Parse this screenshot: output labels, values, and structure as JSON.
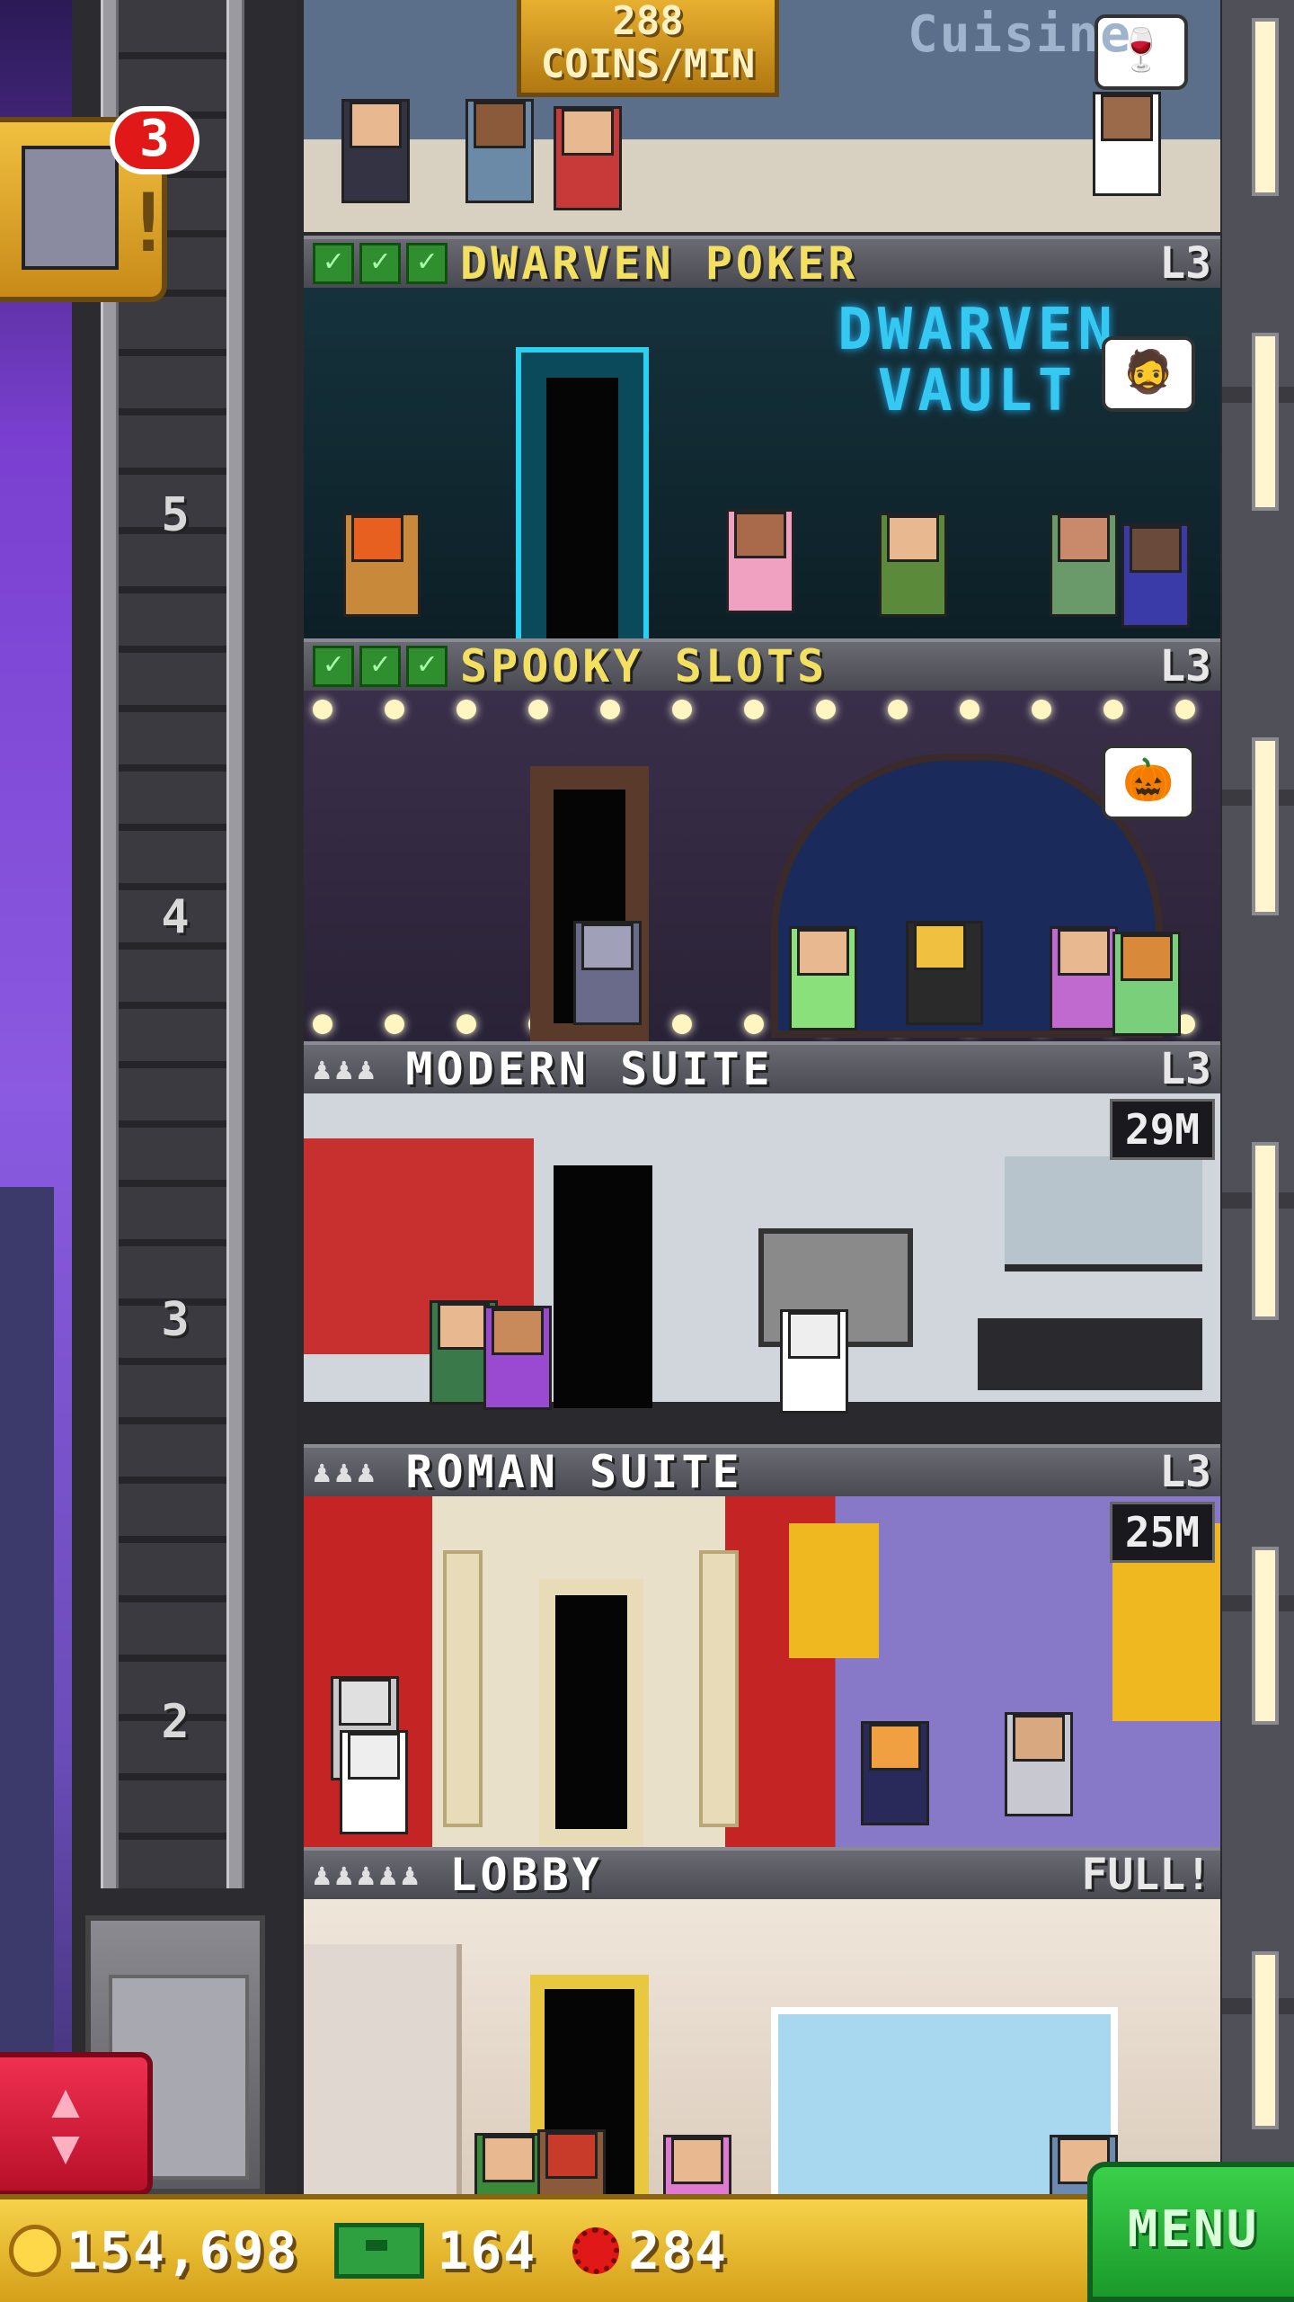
{
  "restaurant": {
    "coins_rate": "288",
    "coins_unit": "COINS/MIN",
    "sign": "Cuisine",
    "bubble_icon": "wine-glass-icon"
  },
  "floors": [
    {
      "name": "DWARVEN POKER",
      "level": "L3",
      "checks": 3,
      "type": "business",
      "sign": [
        "DWARVEN",
        "VAULT"
      ],
      "bubble_icon": "dwarf-icon"
    },
    {
      "name": "SPOOKY SLOTS",
      "level": "L3",
      "checks": 3,
      "type": "business",
      "bubble_icon": "pumpkin-icon"
    },
    {
      "name": "MODERN SUITE",
      "level": "L3",
      "residents": 3,
      "type": "residential",
      "timer": "29M"
    },
    {
      "name": "ROMAN SUITE",
      "level": "L3",
      "residents": 3,
      "type": "residential",
      "timer": "25M"
    },
    {
      "name": "LOBBY",
      "level": "FULL!",
      "residents": 5,
      "type": "lobby"
    }
  ],
  "shaft_floor_numbers": [
    "5",
    "4",
    "3",
    "2"
  ],
  "notification": {
    "count": "3",
    "icon": "zombie-icon"
  },
  "bottom": {
    "coins": "154,698",
    "bux": "164",
    "gears": "284",
    "menu_label": "MENU"
  },
  "colors": {
    "gold": "#f4e060",
    "menu_green": "#2ab83a",
    "elevator_red": "#e02040",
    "neon": "#35c8f0"
  }
}
